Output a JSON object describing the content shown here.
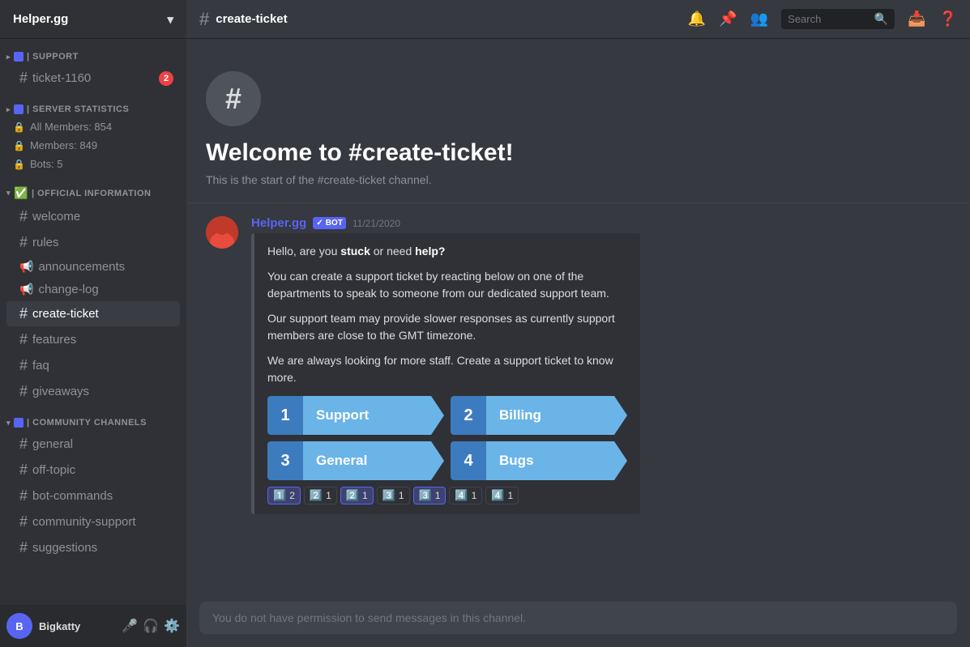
{
  "server": {
    "name": "Helper.gg",
    "chevron": "▾"
  },
  "sidebar": {
    "categories": [
      {
        "id": "support",
        "icon": "▬",
        "label": "SUPPORT",
        "channels": [
          {
            "id": "ticket-1160",
            "name": "ticket-1160",
            "type": "hash",
            "badge": 2
          }
        ]
      },
      {
        "id": "server-statistics",
        "icon": "▬",
        "label": "SERVER STATISTICS",
        "stats": [
          {
            "label": "All Members: 854"
          },
          {
            "label": "Members: 849"
          },
          {
            "label": "Bots: 5"
          }
        ]
      },
      {
        "id": "official-information",
        "icon": "✅",
        "label": "OFFICIAL INFORMATION",
        "channels": [
          {
            "id": "welcome",
            "name": "welcome",
            "type": "hash"
          },
          {
            "id": "rules",
            "name": "rules",
            "type": "hash"
          },
          {
            "id": "announcements",
            "name": "announcements",
            "type": "megaphone"
          },
          {
            "id": "change-log",
            "name": "change-log",
            "type": "megaphone"
          },
          {
            "id": "create-ticket",
            "name": "create-ticket",
            "type": "hash",
            "active": true
          },
          {
            "id": "features",
            "name": "features",
            "type": "hash"
          },
          {
            "id": "faq",
            "name": "faq",
            "type": "hash"
          },
          {
            "id": "giveaways",
            "name": "giveaways",
            "type": "hash"
          }
        ]
      },
      {
        "id": "community-channels",
        "icon": "▬",
        "label": "COMMUNITY CHANNELS",
        "channels": [
          {
            "id": "general",
            "name": "general",
            "type": "hash"
          },
          {
            "id": "off-topic",
            "name": "off-topic",
            "type": "hash"
          },
          {
            "id": "bot-commands",
            "name": "bot-commands",
            "type": "hash"
          },
          {
            "id": "community-support",
            "name": "community-support",
            "type": "hash"
          },
          {
            "id": "suggestions",
            "name": "suggestions",
            "type": "hash"
          }
        ]
      }
    ]
  },
  "topbar": {
    "channel_name": "create-ticket",
    "hash": "#",
    "icons": [
      "🔔",
      "📌",
      "👥"
    ],
    "search_placeholder": "Search"
  },
  "main": {
    "welcome_icon": "#",
    "welcome_title": "Welcome to #create-ticket!",
    "welcome_desc": "This is the start of the #create-ticket channel.",
    "message": {
      "author": "Helper.gg",
      "bot_label": "BOT",
      "timestamp": "11/21/2020",
      "embed": {
        "line1_pre": "Hello, are you ",
        "line1_bold1": "stuck",
        "line1_mid": " or need ",
        "line1_bold2": "help?",
        "line2": "You can create a support ticket by reacting below on one of the departments to speak to someone from our dedicated support team.",
        "line3": "Our support team may provide slower responses as currently support members are close to the GMT timezone.",
        "line4": "We are always looking for more staff. Create a support ticket to know more.",
        "buttons": [
          {
            "num": "1",
            "label": "Support"
          },
          {
            "num": "2",
            "label": "Billing"
          },
          {
            "num": "3",
            "label": "General"
          },
          {
            "num": "4",
            "label": "Bugs"
          }
        ],
        "reactions": [
          {
            "emoji": "1️⃣",
            "count": "2",
            "active": true
          },
          {
            "emoji": "2️⃣",
            "count": "1",
            "active": false
          },
          {
            "emoji": "2️⃣",
            "count": "1",
            "active": true
          },
          {
            "emoji": "3️⃣",
            "count": "1",
            "active": false
          },
          {
            "emoji": "3️⃣",
            "count": "1",
            "active": true
          },
          {
            "emoji": "4️⃣",
            "count": "1",
            "active": false
          },
          {
            "emoji": "4️⃣",
            "count": "1",
            "active": false
          }
        ]
      }
    },
    "input_disabled_text": "You do not have permission to send messages in this channel."
  },
  "footer": {
    "username": "Bigkatty",
    "icons": [
      "🎤",
      "🎧",
      "⚙️"
    ]
  },
  "reactions_display": [
    {
      "emoji": "1️⃣",
      "count": "2",
      "active": true
    },
    {
      "emoji": "2️⃣",
      "count": "1",
      "active": false
    },
    {
      "emoji": "2️⃣",
      "count": "1",
      "active": true
    },
    {
      "emoji": "3️⃣",
      "count": "1",
      "active": false
    },
    {
      "emoji": "3️⃣",
      "count": "1",
      "active": true
    },
    {
      "emoji": "4️⃣",
      "count": "1",
      "active": false
    },
    {
      "emoji": "4️⃣",
      "count": "1",
      "active": false
    }
  ]
}
